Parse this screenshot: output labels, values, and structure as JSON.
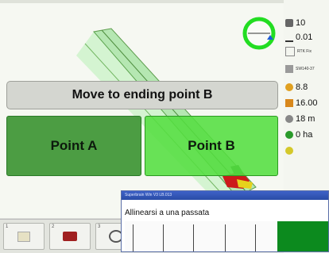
{
  "banner": {
    "text": "Move to ending point B"
  },
  "buttons": {
    "point_a": "Point A",
    "point_b": "Point B"
  },
  "status": {
    "satellites": "10",
    "precision": "0.01",
    "rtk": "RTK Fix",
    "device": "SW140-37",
    "speed": "8.8",
    "width": "16.00",
    "distance": "18 m",
    "area": "0 ha"
  },
  "toolbar": {
    "items": [
      {
        "num": "1",
        "icon": "folder-icon"
      },
      {
        "num": "2",
        "icon": "tractor-icon"
      },
      {
        "num": "3",
        "icon": "tool-icon"
      }
    ]
  },
  "popup": {
    "title": "Superbrain Win V3 LB.013",
    "message": "Allinearsi a una passata"
  },
  "colors": {
    "point_a": "#3e9636",
    "point_b": "#54de40",
    "compass": "#22dd22",
    "popup_green": "#0c8a1e"
  }
}
